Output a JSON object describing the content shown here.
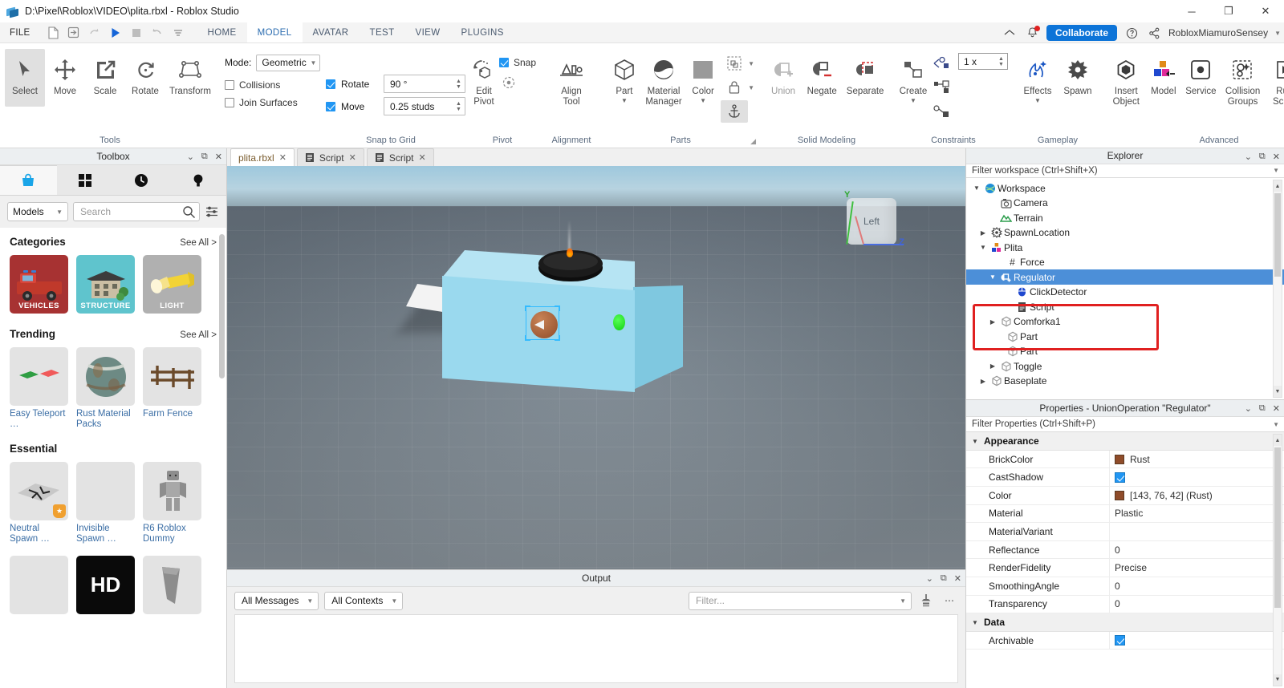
{
  "window": {
    "title": "D:\\Pixel\\Roblox\\VIDEO\\plita.rbxl - Roblox Studio",
    "minimize": "─",
    "maximize": "❐",
    "close": "✕"
  },
  "menu": {
    "file": "FILE",
    "quick_access": [
      "new-file-icon",
      "open-file-icon",
      "redo-icon",
      "play-icon",
      "stop-icon",
      "undo-icon",
      "customize-icon"
    ],
    "tabs": [
      {
        "label": "HOME",
        "active": false
      },
      {
        "label": "MODEL",
        "active": true
      },
      {
        "label": "AVATAR",
        "active": false
      },
      {
        "label": "TEST",
        "active": false
      },
      {
        "label": "VIEW",
        "active": false
      },
      {
        "label": "PLUGINS",
        "active": false
      }
    ],
    "collaborate": "Collaborate",
    "username": "RobloxMiamuroSensey"
  },
  "ribbon": {
    "groups": [
      {
        "caption": "Tools",
        "buttons": [
          {
            "label": "Select",
            "icon": "cursor-arrow-icon",
            "selected": true
          },
          {
            "label": "Move",
            "icon": "move-arrows-icon",
            "selected": false
          },
          {
            "label": "Scale",
            "icon": "scale-icon",
            "selected": false
          },
          {
            "label": "Rotate",
            "icon": "rotate-icon",
            "selected": false
          },
          {
            "label": "Transform",
            "icon": "transform-icon",
            "selected": false
          }
        ]
      },
      {
        "caption": "",
        "mode_label": "Mode:",
        "mode_value": "Geometric",
        "collisions": {
          "label": "Collisions",
          "checked": false
        },
        "join_surfaces": {
          "label": "Join Surfaces",
          "checked": false
        }
      },
      {
        "caption": "Snap to Grid",
        "rotate": {
          "label": "Rotate",
          "checked": true,
          "value": "90 °"
        },
        "move": {
          "label": "Move",
          "checked": true,
          "value": "0.25 studs"
        }
      },
      {
        "caption": "Pivot",
        "edit_pivot": "Edit\nPivot",
        "snap": {
          "label": "Snap",
          "checked": true
        }
      },
      {
        "caption": "Alignment",
        "buttons": [
          {
            "label": "Align\nTool",
            "icon": "align-tool-icon"
          }
        ]
      },
      {
        "caption": "Parts",
        "buttons": [
          {
            "label": "Part",
            "icon": "cube-icon",
            "dropdown": true
          },
          {
            "label": "Material\nManager",
            "icon": "material-sphere-icon"
          },
          {
            "label": "Color",
            "icon": "color-square-icon",
            "dropdown": true
          }
        ],
        "side_buttons": [
          {
            "icon": "group-icon",
            "dropdown": true
          },
          {
            "icon": "lock-icon",
            "dropdown": true
          },
          {
            "icon": "anchor-icon",
            "selected": true
          }
        ]
      },
      {
        "caption": "Solid Modeling",
        "buttons": [
          {
            "label": "Union",
            "icon": "union-icon",
            "dim": true
          },
          {
            "label": "Negate",
            "icon": "negate-icon",
            "dim": false
          },
          {
            "label": "Separate",
            "icon": "separate-icon",
            "dim": false
          }
        ]
      },
      {
        "caption": "Constraints",
        "buttons": [
          {
            "label": "Create",
            "icon": "constraint-create-icon",
            "dropdown": true
          }
        ],
        "side_buttons": [
          {
            "icon": "show-constraints-icon"
          },
          {
            "icon": "constraint-details-icon"
          },
          {
            "icon": "constraint-welds-icon"
          }
        ],
        "scale_value": "1 x"
      },
      {
        "caption": "Gameplay",
        "buttons": [
          {
            "label": "Effects",
            "icon": "effects-icon",
            "dropdown": true
          },
          {
            "label": "Spawn",
            "icon": "spawn-gear-icon"
          }
        ]
      },
      {
        "caption": "Advanced",
        "buttons": [
          {
            "label": "Insert\nObject",
            "icon": "insert-object-icon"
          },
          {
            "label": "Model",
            "icon": "model-icon"
          },
          {
            "label": "Service",
            "icon": "service-icon"
          },
          {
            "label": "Collision\nGroups",
            "icon": "collision-groups-icon"
          },
          {
            "label": "Run\nScript",
            "icon": "run-script-icon"
          }
        ],
        "side_buttons": [
          {
            "icon": "script-icon"
          },
          {
            "icon": "local-script-icon"
          },
          {
            "icon": "module-script-icon"
          }
        ]
      }
    ]
  },
  "toolbox": {
    "title": "Toolbox",
    "tabs": [
      {
        "icon": "marketplace-bag-icon",
        "active": true
      },
      {
        "icon": "inventory-grid-icon",
        "active": false
      },
      {
        "icon": "recent-clock-icon",
        "active": false
      },
      {
        "icon": "creations-bulb-icon",
        "active": false
      }
    ],
    "type_filter": "Models",
    "search_placeholder": "Search",
    "sections": [
      {
        "title": "Categories",
        "see_all": "See All >",
        "items": [
          {
            "name": "VEHICLES",
            "thumb": "fire-truck-thumb",
            "bg": "#a73232"
          },
          {
            "name": "STRUCTURE",
            "thumb": "house-thumb",
            "bg": "#5fc4cd"
          },
          {
            "name": "LIGHT",
            "thumb": "flashlight-thumb",
            "bg": "#b0b0b0"
          }
        ]
      },
      {
        "title": "Trending",
        "see_all": "See All >",
        "items": [
          {
            "name": "Easy Teleport …",
            "thumb": "teleport-pads-thumb"
          },
          {
            "name": "Rust Material Packs",
            "thumb": "rust-barrel-thumb"
          },
          {
            "name": "Farm Fence",
            "thumb": "fence-thumb"
          }
        ]
      },
      {
        "title": "Essential",
        "see_all": "",
        "items": [
          {
            "name": "Neutral Spawn …",
            "thumb": "neutral-spawn-thumb"
          },
          {
            "name": "Invisible Spawn …",
            "thumb": "invisible-spawn-thumb"
          },
          {
            "name": "R6 Roblox Dummy",
            "thumb": "r6-dummy-thumb"
          }
        ]
      },
      {
        "title": "",
        "see_all": "",
        "items": [
          {
            "name": "",
            "thumb": "blank-thumb"
          },
          {
            "name": "",
            "thumb": "hd-thumb"
          },
          {
            "name": "",
            "thumb": "wedge-thumb"
          }
        ]
      }
    ]
  },
  "doc_tabs": [
    {
      "label": "plita.rbxl",
      "icon": "",
      "active": true,
      "close": "✕"
    },
    {
      "label": "Script",
      "icon": "script-icon",
      "active": false,
      "close": "✕"
    },
    {
      "label": "Script",
      "icon": "script-icon",
      "active": false,
      "close": "✕"
    }
  ],
  "viewport": {
    "viewcube_face": "Left",
    "axis_y": "Y",
    "axis_z": "Z"
  },
  "output": {
    "title": "Output",
    "message_filter": "All Messages",
    "context_filter": "All Contexts",
    "filter_placeholder": "Filter...",
    "clear_icon": "clear-output-icon",
    "more_icon": "more-options-icon",
    "collapse": "⌄",
    "popout": "⤡",
    "close": "✕",
    "lines": []
  },
  "explorer": {
    "title": "Explorer",
    "filter_placeholder": "Filter workspace (Ctrl+Shift+X)",
    "collapse": "⌄",
    "popout": "⤡",
    "close": "✕",
    "nodes": [
      {
        "label": "Workspace",
        "icon": "workspace-globe-icon",
        "depth": 0,
        "twist": "▼",
        "selected": false
      },
      {
        "label": "Camera",
        "icon": "camera-icon",
        "depth": 1,
        "twist": "",
        "selected": false
      },
      {
        "label": "Terrain",
        "icon": "terrain-icon",
        "depth": 1,
        "twist": "",
        "selected": false
      },
      {
        "label": "SpawnLocation",
        "icon": "spawn-location-icon",
        "depth": 1,
        "twist": "▶",
        "selected": false
      },
      {
        "label": "Plita",
        "icon": "model-icon",
        "depth": 1,
        "twist": "▼",
        "selected": false
      },
      {
        "label": "Force",
        "icon": "number-value-icon",
        "depth": 2,
        "twist": "",
        "selected": false
      },
      {
        "label": "Regulator",
        "icon": "union-operation-icon",
        "depth": 2,
        "twist": "▼",
        "selected": true
      },
      {
        "label": "ClickDetector",
        "icon": "click-detector-icon",
        "depth": 3,
        "twist": "",
        "selected": false
      },
      {
        "label": "Script",
        "icon": "script-icon",
        "depth": 3,
        "twist": "",
        "selected": false
      },
      {
        "label": "Comforka1",
        "icon": "part-icon",
        "depth": 2,
        "twist": "▶",
        "selected": false
      },
      {
        "label": "Part",
        "icon": "part-icon",
        "depth": 2,
        "twist": "",
        "selected": false
      },
      {
        "label": "Part",
        "icon": "part-icon",
        "depth": 2,
        "twist": "",
        "selected": false
      },
      {
        "label": "Toggle",
        "icon": "part-icon",
        "depth": 2,
        "twist": "▶",
        "selected": false
      },
      {
        "label": "Baseplate",
        "icon": "part-icon",
        "depth": 1,
        "twist": "▶",
        "selected": false
      }
    ],
    "highlight_color": "#e02020"
  },
  "properties": {
    "title": "Properties - UnionOperation \"Regulator\"",
    "filter_placeholder": "Filter Properties (Ctrl+Shift+P)",
    "collapse": "⌄",
    "popout": "⤡",
    "close": "✕",
    "categories": [
      {
        "name": "Appearance",
        "twist": "▼",
        "rows": [
          {
            "name": "BrickColor",
            "value": "Rust",
            "type": "color",
            "color": "#8f4c2a"
          },
          {
            "name": "CastShadow",
            "value": "",
            "type": "checkbox",
            "checked": true
          },
          {
            "name": "Color",
            "value": "[143, 76, 42] (Rust)",
            "type": "color",
            "color": "#8f4c2a"
          },
          {
            "name": "Material",
            "value": "Plastic",
            "type": "text"
          },
          {
            "name": "MaterialVariant",
            "value": "",
            "type": "text"
          },
          {
            "name": "Reflectance",
            "value": "0",
            "type": "text"
          },
          {
            "name": "RenderFidelity",
            "value": "Precise",
            "type": "text"
          },
          {
            "name": "SmoothingAngle",
            "value": "0",
            "type": "text"
          },
          {
            "name": "Transparency",
            "value": "0",
            "type": "text"
          }
        ]
      },
      {
        "name": "Data",
        "twist": "▼",
        "rows": [
          {
            "name": "Archivable",
            "value": "",
            "type": "checkbox",
            "checked": true
          }
        ]
      }
    ]
  }
}
